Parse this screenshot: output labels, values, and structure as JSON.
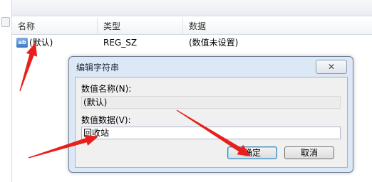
{
  "list": {
    "headers": {
      "name": "名称",
      "type": "类型",
      "data": "数据"
    },
    "rows": [
      {
        "icon": "ab-string-value-icon",
        "icon_text": "ab",
        "name": "(默认)",
        "type": "REG_SZ",
        "data": "(数值未设置)"
      }
    ]
  },
  "dialog": {
    "title": "编辑字符串",
    "close_label": "✕",
    "value_name_label": "数值名称(N):",
    "value_name": "(默认)",
    "value_data_label": "数值数据(V):",
    "value_data": "回收站",
    "ok_label": "确定",
    "cancel_label": "取消"
  },
  "annotation": {
    "arrow_color": "#e8201c"
  }
}
